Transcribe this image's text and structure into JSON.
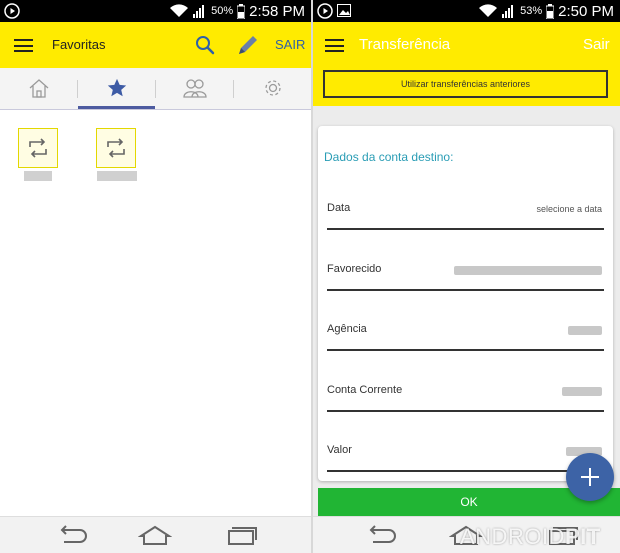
{
  "left_screen": {
    "status_bar": {
      "battery_pct": "50%",
      "time": "2:58 PM"
    },
    "app_bar": {
      "title": "Favoritas",
      "action_label": "SAIR",
      "title_color": "#222222",
      "action_color": "#2e60a8"
    },
    "tabs": [
      {
        "icon": "home-icon",
        "selected": false
      },
      {
        "icon": "star-icon",
        "selected": true
      },
      {
        "icon": "people-icon",
        "selected": false
      },
      {
        "icon": "gear-icon",
        "selected": false
      }
    ],
    "favorites": [
      {
        "icon": "transfer-icon"
      },
      {
        "icon": "transfer-icon"
      }
    ]
  },
  "right_screen": {
    "status_bar": {
      "battery_pct": "53%",
      "time": "2:50 PM"
    },
    "app_bar": {
      "title": "Transferência",
      "action_label": "Sair"
    },
    "reuse_button": "Utilizar transferências anteriores",
    "form": {
      "title": "Dados da conta destino:",
      "fields": [
        {
          "label": "Data",
          "value": "selecione a data"
        },
        {
          "label": "Favorecido",
          "value": ""
        },
        {
          "label": "Agência",
          "value": ""
        },
        {
          "label": "Conta Corrente",
          "value": ""
        },
        {
          "label": "Valor",
          "value": ""
        }
      ]
    },
    "ok_button": "OK",
    "fab_icon": "plus-icon"
  },
  "watermark": {
    "part1": "ANDROID",
    "part2": "PIT"
  },
  "colors": {
    "brand_yellow": "#ffeb00",
    "accent_blue": "#3d63a6",
    "ok_green": "#21b534",
    "title_teal": "#2a9db5"
  }
}
